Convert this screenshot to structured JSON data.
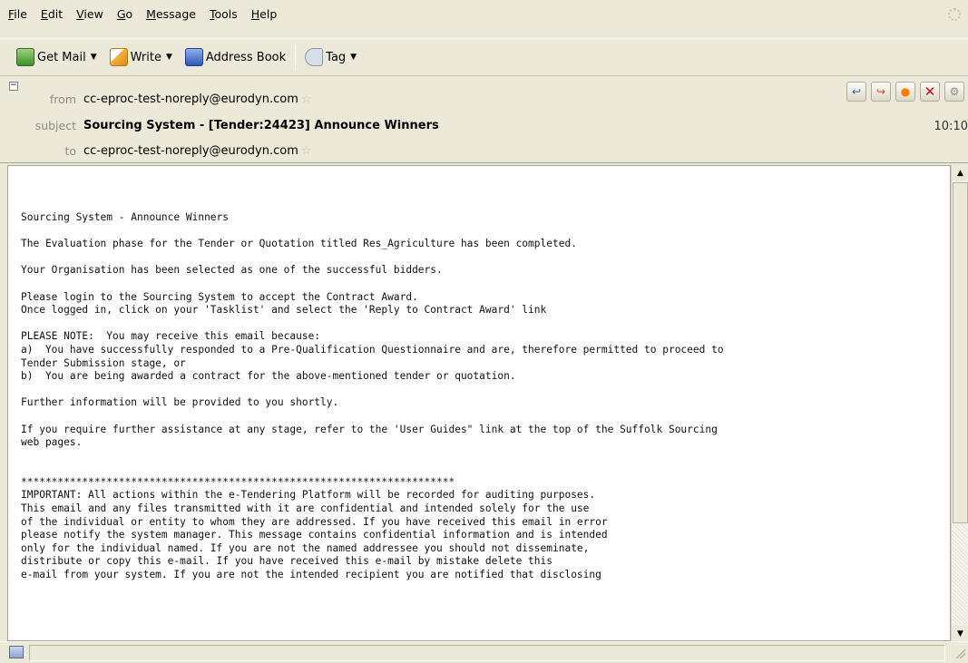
{
  "menu": [
    {
      "accel": "F",
      "rest": "ile"
    },
    {
      "accel": "E",
      "rest": "dit"
    },
    {
      "accel": "V",
      "rest": "iew"
    },
    {
      "accel": "G",
      "rest": "o"
    },
    {
      "accel": "M",
      "rest": "essage"
    },
    {
      "accel": "T",
      "rest": "ools"
    },
    {
      "accel": "H",
      "rest": "elp"
    }
  ],
  "toolbar": {
    "get_mail": "Get Mail",
    "write": "Write",
    "address_book": "Address Book",
    "tag": "Tag"
  },
  "header": {
    "from_label": "from",
    "from_value": "cc-eproc-test-noreply@eurodyn.com",
    "subject_label": "subject",
    "subject_value": "Sourcing System - [Tender:24423] Announce Winners",
    "to_label": "to",
    "to_value": "cc-eproc-test-noreply@eurodyn.com",
    "time": "10:10"
  },
  "message": {
    "body": "Sourcing System - Announce Winners\n\nThe Evaluation phase for the Tender or Quotation titled Res_Agriculture has been completed.\n\nYour Organisation has been selected as one of the successful bidders.\n\nPlease login to the Sourcing System to accept the Contract Award.\nOnce logged in, click on your 'Tasklist' and select the 'Reply to Contract Award' link\n\nPLEASE NOTE:  You may receive this email because:\na)  You have successfully responded to a Pre-Qualification Questionnaire and are, therefore permitted to proceed to\nTender Submission stage, or\nb)  You are being awarded a contract for the above-mentioned tender or quotation.\n\nFurther information will be provided to you shortly.\n\nIf you require further assistance at any stage, refer to the 'User Guides\" link at the top of the Suffolk Sourcing\nweb pages.\n\n\n***********************************************************************\nIMPORTANT: All actions within the e-Tendering Platform will be recorded for auditing purposes.\nThis email and any files transmitted with it are confidential and intended solely for the use\nof the individual or entity to whom they are addressed. If you have received this email in error\nplease notify the system manager. This message contains confidential information and is intended\nonly for the individual named. If you are not the named addressee you should not disseminate,\ndistribute or copy this e-mail. If you have received this e-mail by mistake delete this\ne-mail from your system. If you are not the intended recipient you are notified that disclosing"
  }
}
